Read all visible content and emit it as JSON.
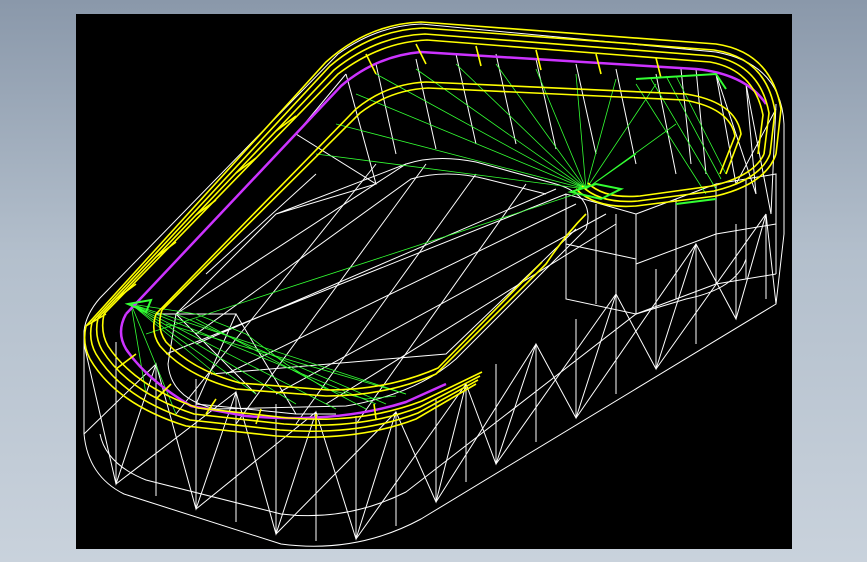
{
  "viewport": {
    "background": "#000000",
    "page_background": "#b3bfcc"
  },
  "model": {
    "render_style": "wireframe",
    "shape": "stadium-shaped tray with slot",
    "edge_colors": {
      "mesh": "#ffffff",
      "rim": "#ffff00",
      "inner_rim": "#cc33ff",
      "triangulation": "#33ff33"
    }
  }
}
